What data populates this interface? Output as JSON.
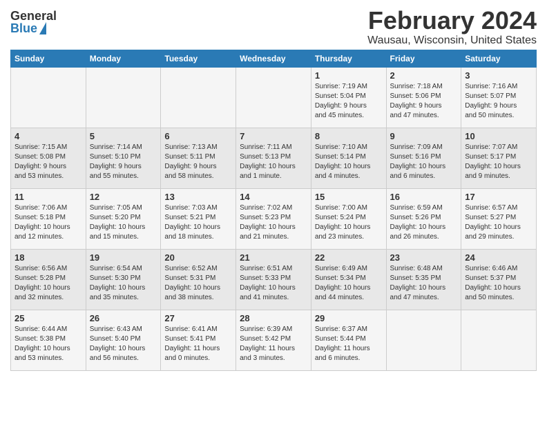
{
  "header": {
    "logo_general": "General",
    "logo_blue": "Blue",
    "month_year": "February 2024",
    "location": "Wausau, Wisconsin, United States"
  },
  "days_of_week": [
    "Sunday",
    "Monday",
    "Tuesday",
    "Wednesday",
    "Thursday",
    "Friday",
    "Saturday"
  ],
  "weeks": [
    [
      {
        "day": "",
        "info": ""
      },
      {
        "day": "",
        "info": ""
      },
      {
        "day": "",
        "info": ""
      },
      {
        "day": "",
        "info": ""
      },
      {
        "day": "1",
        "info": "Sunrise: 7:19 AM\nSunset: 5:04 PM\nDaylight: 9 hours\nand 45 minutes."
      },
      {
        "day": "2",
        "info": "Sunrise: 7:18 AM\nSunset: 5:06 PM\nDaylight: 9 hours\nand 47 minutes."
      },
      {
        "day": "3",
        "info": "Sunrise: 7:16 AM\nSunset: 5:07 PM\nDaylight: 9 hours\nand 50 minutes."
      }
    ],
    [
      {
        "day": "4",
        "info": "Sunrise: 7:15 AM\nSunset: 5:08 PM\nDaylight: 9 hours\nand 53 minutes."
      },
      {
        "day": "5",
        "info": "Sunrise: 7:14 AM\nSunset: 5:10 PM\nDaylight: 9 hours\nand 55 minutes."
      },
      {
        "day": "6",
        "info": "Sunrise: 7:13 AM\nSunset: 5:11 PM\nDaylight: 9 hours\nand 58 minutes."
      },
      {
        "day": "7",
        "info": "Sunrise: 7:11 AM\nSunset: 5:13 PM\nDaylight: 10 hours\nand 1 minute."
      },
      {
        "day": "8",
        "info": "Sunrise: 7:10 AM\nSunset: 5:14 PM\nDaylight: 10 hours\nand 4 minutes."
      },
      {
        "day": "9",
        "info": "Sunrise: 7:09 AM\nSunset: 5:16 PM\nDaylight: 10 hours\nand 6 minutes."
      },
      {
        "day": "10",
        "info": "Sunrise: 7:07 AM\nSunset: 5:17 PM\nDaylight: 10 hours\nand 9 minutes."
      }
    ],
    [
      {
        "day": "11",
        "info": "Sunrise: 7:06 AM\nSunset: 5:18 PM\nDaylight: 10 hours\nand 12 minutes."
      },
      {
        "day": "12",
        "info": "Sunrise: 7:05 AM\nSunset: 5:20 PM\nDaylight: 10 hours\nand 15 minutes."
      },
      {
        "day": "13",
        "info": "Sunrise: 7:03 AM\nSunset: 5:21 PM\nDaylight: 10 hours\nand 18 minutes."
      },
      {
        "day": "14",
        "info": "Sunrise: 7:02 AM\nSunset: 5:23 PM\nDaylight: 10 hours\nand 21 minutes."
      },
      {
        "day": "15",
        "info": "Sunrise: 7:00 AM\nSunset: 5:24 PM\nDaylight: 10 hours\nand 23 minutes."
      },
      {
        "day": "16",
        "info": "Sunrise: 6:59 AM\nSunset: 5:26 PM\nDaylight: 10 hours\nand 26 minutes."
      },
      {
        "day": "17",
        "info": "Sunrise: 6:57 AM\nSunset: 5:27 PM\nDaylight: 10 hours\nand 29 minutes."
      }
    ],
    [
      {
        "day": "18",
        "info": "Sunrise: 6:56 AM\nSunset: 5:28 PM\nDaylight: 10 hours\nand 32 minutes."
      },
      {
        "day": "19",
        "info": "Sunrise: 6:54 AM\nSunset: 5:30 PM\nDaylight: 10 hours\nand 35 minutes."
      },
      {
        "day": "20",
        "info": "Sunrise: 6:52 AM\nSunset: 5:31 PM\nDaylight: 10 hours\nand 38 minutes."
      },
      {
        "day": "21",
        "info": "Sunrise: 6:51 AM\nSunset: 5:33 PM\nDaylight: 10 hours\nand 41 minutes."
      },
      {
        "day": "22",
        "info": "Sunrise: 6:49 AM\nSunset: 5:34 PM\nDaylight: 10 hours\nand 44 minutes."
      },
      {
        "day": "23",
        "info": "Sunrise: 6:48 AM\nSunset: 5:35 PM\nDaylight: 10 hours\nand 47 minutes."
      },
      {
        "day": "24",
        "info": "Sunrise: 6:46 AM\nSunset: 5:37 PM\nDaylight: 10 hours\nand 50 minutes."
      }
    ],
    [
      {
        "day": "25",
        "info": "Sunrise: 6:44 AM\nSunset: 5:38 PM\nDaylight: 10 hours\nand 53 minutes."
      },
      {
        "day": "26",
        "info": "Sunrise: 6:43 AM\nSunset: 5:40 PM\nDaylight: 10 hours\nand 56 minutes."
      },
      {
        "day": "27",
        "info": "Sunrise: 6:41 AM\nSunset: 5:41 PM\nDaylight: 11 hours\nand 0 minutes."
      },
      {
        "day": "28",
        "info": "Sunrise: 6:39 AM\nSunset: 5:42 PM\nDaylight: 11 hours\nand 3 minutes."
      },
      {
        "day": "29",
        "info": "Sunrise: 6:37 AM\nSunset: 5:44 PM\nDaylight: 11 hours\nand 6 minutes."
      },
      {
        "day": "",
        "info": ""
      },
      {
        "day": "",
        "info": ""
      }
    ]
  ]
}
